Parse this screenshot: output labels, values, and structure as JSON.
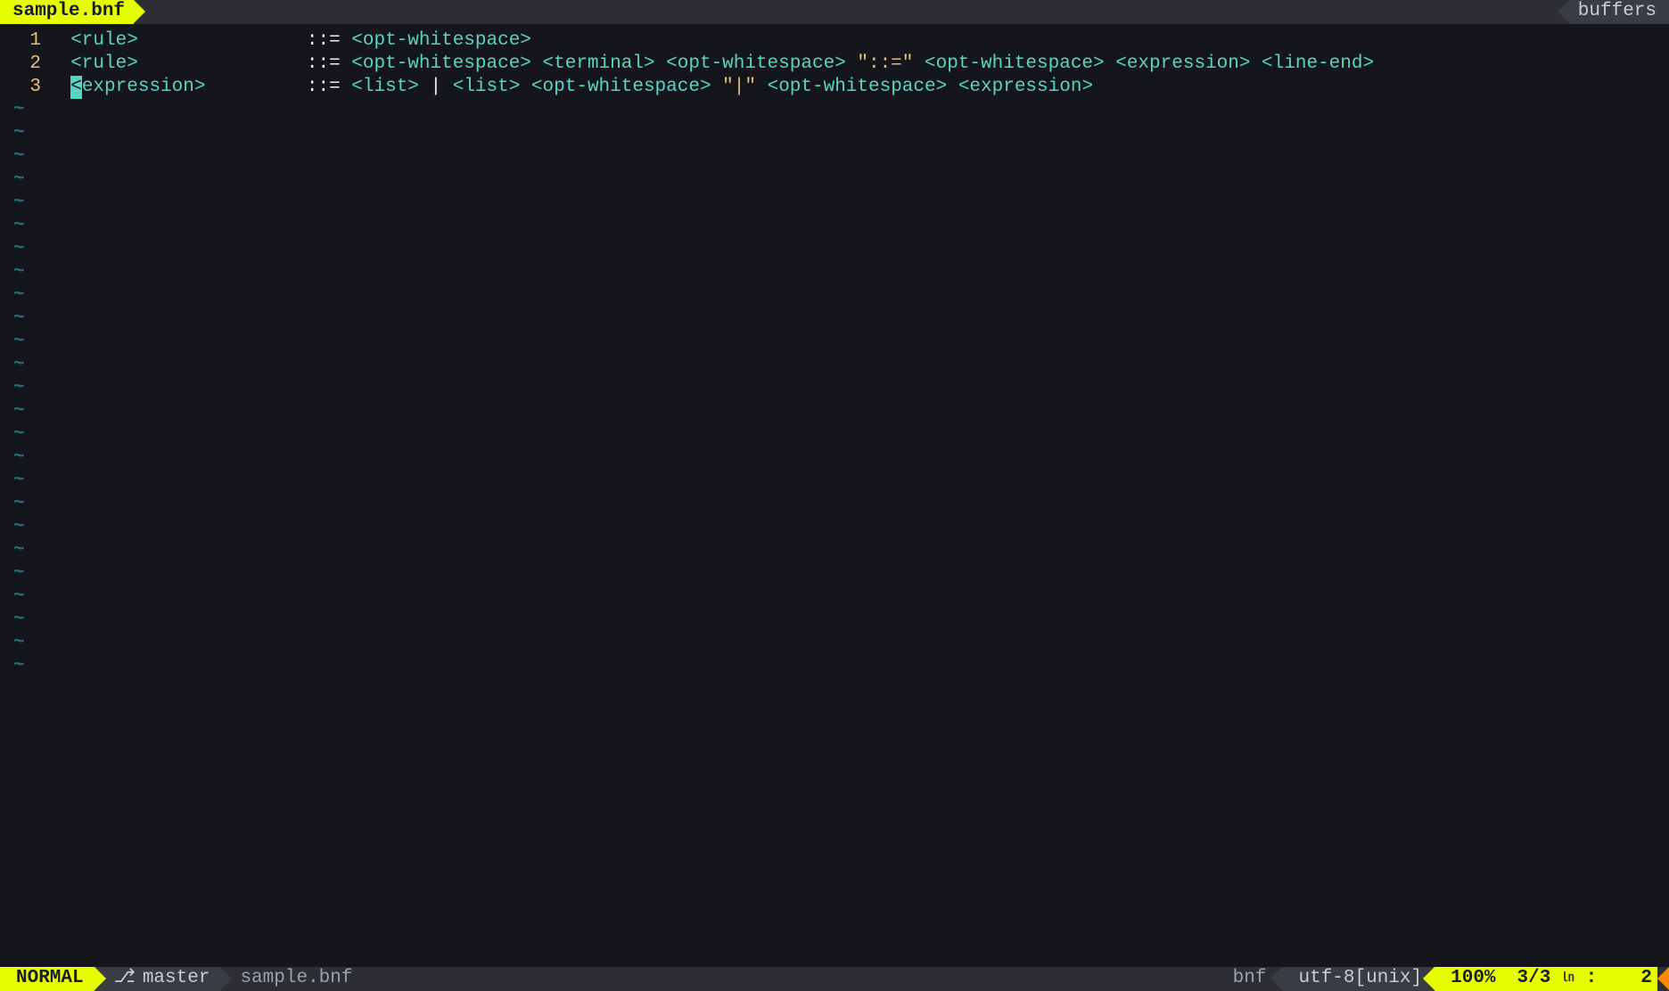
{
  "tabline": {
    "active_tab": "sample.bnf",
    "right_label": "buffers"
  },
  "editor": {
    "tilde": "~",
    "empty_line_count": 25,
    "cursor": {
      "line_index": 2,
      "col": 0
    },
    "lines": [
      {
        "nr": "1",
        "tokens": [
          {
            "cls": "tok-nonterm",
            "text": "  <rule>"
          },
          {
            "cls": "tok-op",
            "text": "               ::= "
          },
          {
            "cls": "tok-nonterm",
            "text": "<opt-whitespace>"
          }
        ]
      },
      {
        "nr": "2",
        "tokens": [
          {
            "cls": "tok-nonterm",
            "text": "  <rule>"
          },
          {
            "cls": "tok-op",
            "text": "               ::= "
          },
          {
            "cls": "tok-nonterm",
            "text": "<opt-whitespace> <terminal> <opt-whitespace> "
          },
          {
            "cls": "tok-string",
            "text": "\"::=\""
          },
          {
            "cls": "tok-nonterm",
            "text": " <opt-whitespace> <expression> <line-end>"
          }
        ]
      },
      {
        "nr": "3",
        "tokens": [
          {
            "cls": "tok-op",
            "text": "  "
          },
          {
            "cls": "tok-nonterm cursor-start",
            "text": "<expression>"
          },
          {
            "cls": "tok-op",
            "text": "         ::= "
          },
          {
            "cls": "tok-nonterm",
            "text": "<list>"
          },
          {
            "cls": "tok-pipe",
            "text": " | "
          },
          {
            "cls": "tok-nonterm",
            "text": "<list> <opt-whitespace> "
          },
          {
            "cls": "tok-string",
            "text": "\"|\""
          },
          {
            "cls": "tok-nonterm",
            "text": " <opt-whitespace> <expression>"
          }
        ]
      }
    ]
  },
  "statusline": {
    "mode": "NORMAL",
    "branch_icon": "⎇",
    "branch": "master",
    "filename": "sample.bnf",
    "filetype": "bnf",
    "encoding": "utf-8[unix]",
    "percent": "100%",
    "line_total": "3/3",
    "ln_icon": "㏑",
    "colon": ":",
    "col": "2"
  }
}
